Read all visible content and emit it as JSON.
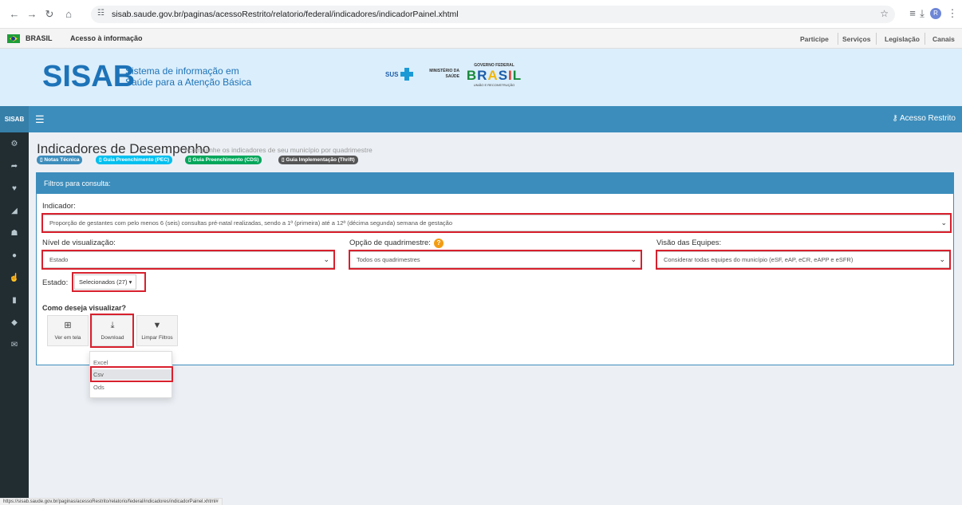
{
  "browser": {
    "url": "sisab.saude.gov.br/paginas/acessoRestrito/relatorio/federal/indicadores/indicadorPainel.xhtml",
    "profile_initial": "R"
  },
  "govbar": {
    "brasil": "BRASIL",
    "acesso_info": "Acesso à informação",
    "links": [
      "Participe",
      "Serviços",
      "Legislação",
      "Canais"
    ]
  },
  "banner": {
    "logo": "SISAB",
    "subtitle_line1": "Sistema de informação em",
    "subtitle_line2": "Saúde para a Atenção Básica",
    "sus": "SUS",
    "ministerio_line1": "MINISTÉRIO DA",
    "ministerio_line2": "SAÚDE",
    "gov_federal": "GOVERNO FEDERAL",
    "brasil": "BRASIL",
    "uniao": "UNIÃO E RECONSTRUÇÃO"
  },
  "topnav": {
    "brand": "SISAB",
    "acesso_restrito": "Acesso Restrito"
  },
  "page": {
    "title": "Indicadores de Desempenho",
    "subtitle": "Acompanhe os indicadores de seu município por quadrimestre",
    "badges": [
      "Notas Técnica",
      "Guia Preenchimento (PEC)",
      "Guia Preenchimento (CDS)",
      "Guia Implementação (Thrift)"
    ]
  },
  "filters": {
    "panel_title": "Filtros para consulta:",
    "indicador_label": "Indicador:",
    "indicador_value": "Proporção de gestantes com pelo menos 6 (seis) consultas pré-natal realizadas, sendo a 1ª (primeira) até a 12ª (décima segunda) semana de gestação",
    "nivel_label": "Nível de visualização:",
    "nivel_value": "Estado",
    "quadrimestre_label": "Opção de quadrimestre:",
    "quadrimestre_value": "Todos os quadrimestres",
    "equipes_label": "Visão das Equipes:",
    "equipes_value": "Considerar todas equipes do município (eSF, eAP, eCR, eAPP e eSFR)",
    "estado_label": "Estado:",
    "estado_value": "Selecionados (27)"
  },
  "view": {
    "title": "Como deseja visualizar?",
    "buttons": [
      "Ver em tela",
      "Download",
      "Limpar Filtros"
    ],
    "download_options": [
      "Excel",
      "Csv",
      "Ods"
    ]
  },
  "status_url": "https://sisab.saude.gov.br/paginas/acessoRestrito/relatorio/federal/indicadores/indicadorPainel.xhtml#",
  "colors": {
    "primary": "#3c8dbc",
    "sidebar": "#222d32",
    "highlight": "#d8202d",
    "banner": "#dbeefb"
  }
}
